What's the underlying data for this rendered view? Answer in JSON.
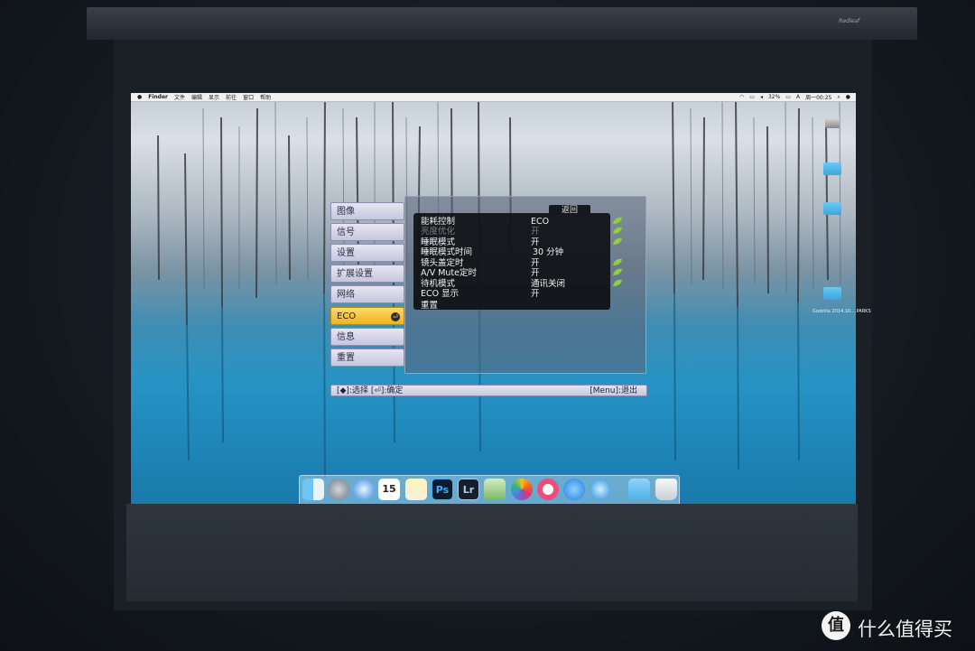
{
  "menubar": {
    "items": [
      "Finder",
      "文件",
      "编辑",
      "显示",
      "前往",
      "窗口",
      "帮助"
    ],
    "battery": "32%",
    "input_indicator": "A",
    "clock": "周一00:25"
  },
  "desktop_icons": [
    {
      "label": "Godzilla 2014.10....PARKS"
    }
  ],
  "osd": {
    "back_label": "返回",
    "categories": [
      {
        "label": "图像",
        "active": false
      },
      {
        "label": "信号",
        "active": false
      },
      {
        "label": "设置",
        "active": false
      },
      {
        "label": "扩展设置",
        "active": false
      },
      {
        "label": "网络",
        "active": false
      },
      {
        "label": "ECO",
        "active": true
      },
      {
        "label": "信息",
        "active": false
      },
      {
        "label": "重置",
        "active": false
      }
    ],
    "rows": [
      {
        "label": "能耗控制",
        "value": "ECO",
        "dim": false,
        "leaf": true
      },
      {
        "label": "亮度优化",
        "value": "开",
        "dim": true,
        "leaf": true
      },
      {
        "label": "睡眠模式",
        "value": "开",
        "dim": false,
        "leaf": true
      },
      {
        "label": "睡眠模式时间",
        "value": "30 分钟",
        "dim": false,
        "leaf": false
      },
      {
        "label": "镜头盖定时",
        "value": "开",
        "dim": false,
        "leaf": true
      },
      {
        "label": "A/V Mute定时",
        "value": "开",
        "dim": false,
        "leaf": true
      },
      {
        "label": "待机模式",
        "value": "通讯关闭",
        "dim": false,
        "leaf": true
      },
      {
        "label": "ECO 显示",
        "value": "开",
        "dim": false,
        "leaf": false
      },
      {
        "label": "重置",
        "value": "",
        "dim": false,
        "leaf": false
      }
    ],
    "footer_left": "[◆]:选择 [⏎]:确定",
    "footer_right": "[Menu]:退出"
  },
  "dock": {
    "apps": [
      "finder",
      "launchpad",
      "safari",
      "calendar",
      "notes",
      "Ps",
      "Lr",
      "preview",
      "photos",
      "itunes",
      "app-store",
      "quicktime",
      "downloads",
      "trash"
    ],
    "calendar_day": "15",
    "ps_label": "Ps",
    "lr_label": "Lr"
  },
  "watermark": {
    "logo": "值",
    "text": "什么值得买"
  },
  "housing_brand": "Redleaf"
}
